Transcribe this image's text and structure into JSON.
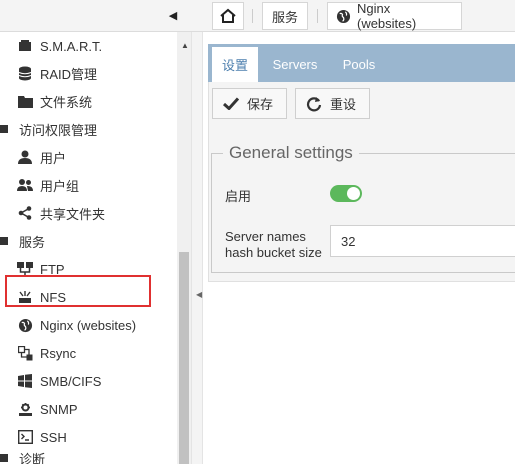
{
  "breadcrumb": {
    "home_icon": "home-icon",
    "items": [
      "服务",
      "Nginx (websites)"
    ]
  },
  "sidebar": {
    "items": [
      {
        "label": "S.M.A.R.T.",
        "icon": "smart-icon"
      },
      {
        "label": "RAID管理",
        "icon": "database-icon"
      },
      {
        "label": "文件系统",
        "icon": "folder-icon"
      }
    ],
    "group_access": "访问权限管理",
    "access_items": [
      {
        "label": "用户",
        "icon": "user-icon"
      },
      {
        "label": "用户组",
        "icon": "users-icon"
      },
      {
        "label": "共享文件夹",
        "icon": "share-icon"
      }
    ],
    "group_services": "服务",
    "service_items": [
      {
        "label": "FTP",
        "icon": "ftp-icon"
      },
      {
        "label": "NFS",
        "icon": "nfs-icon"
      },
      {
        "label": "Nginx (websites)",
        "icon": "globe-icon"
      },
      {
        "label": "Rsync",
        "icon": "rsync-icon"
      },
      {
        "label": "SMB/CIFS",
        "icon": "windows-icon"
      },
      {
        "label": "SNMP",
        "icon": "snmp-icon"
      },
      {
        "label": "SSH",
        "icon": "terminal-icon"
      }
    ],
    "group_diag": "诊断"
  },
  "tabs": [
    "设置",
    "Servers",
    "Pools"
  ],
  "toolbar": {
    "save_label": "保存",
    "reset_label": "重设"
  },
  "form": {
    "legend": "General settings",
    "enable_label": "启用",
    "enabled": true,
    "hash_label_line1": "Server names",
    "hash_label_line2": "hash bucket size",
    "hash_value": "32"
  },
  "colors": {
    "accent": "#9ab6cf",
    "toggle_on": "#5cb85c",
    "highlight": "#e03030"
  }
}
